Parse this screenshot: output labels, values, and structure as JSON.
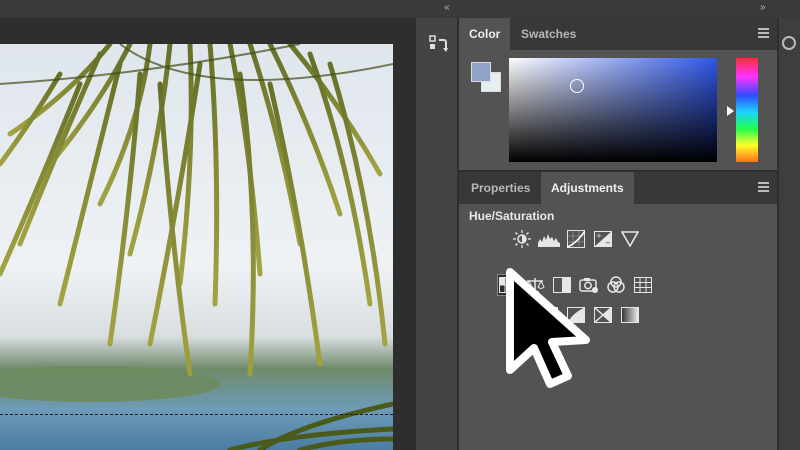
{
  "top_bar": {
    "collapse_left_glyph": "«",
    "collapse_right_glyph": "»"
  },
  "history_column": {
    "history_icon": "history-brush-icon"
  },
  "color_panel": {
    "tabs": [
      {
        "label": "Color",
        "active": true
      },
      {
        "label": "Swatches",
        "active": false
      }
    ],
    "foreground_color": "#8fa3c7",
    "background_color": "#e6eef2",
    "field_hue": "#2f56e6",
    "menu_icon": "panel-menu-icon"
  },
  "adjustments_panel": {
    "tabs": [
      {
        "label": "Properties",
        "active": false
      },
      {
        "label": "Adjustments",
        "active": true
      }
    ],
    "hovered_title": "Hue/Saturation",
    "menu_icon": "panel-menu-icon",
    "row1_icons": [
      "brightness-contrast-icon",
      "levels-icon",
      "curves-icon",
      "exposure-icon",
      "gradient-triangle-icon"
    ],
    "row2_icons": [
      "hue-saturation-icon",
      "color-balance-icon",
      "black-white-icon",
      "photo-filter-icon",
      "channel-mixer-icon",
      "color-lookup-icon"
    ],
    "row3_icons": [
      "invert-icon",
      "posterize-icon",
      "threshold-icon",
      "gradient-map-icon",
      "selective-color-icon"
    ]
  },
  "right_edge": {
    "icon": "libraries-icon"
  },
  "cursor": {
    "icon": "mouse-pointer-icon"
  }
}
